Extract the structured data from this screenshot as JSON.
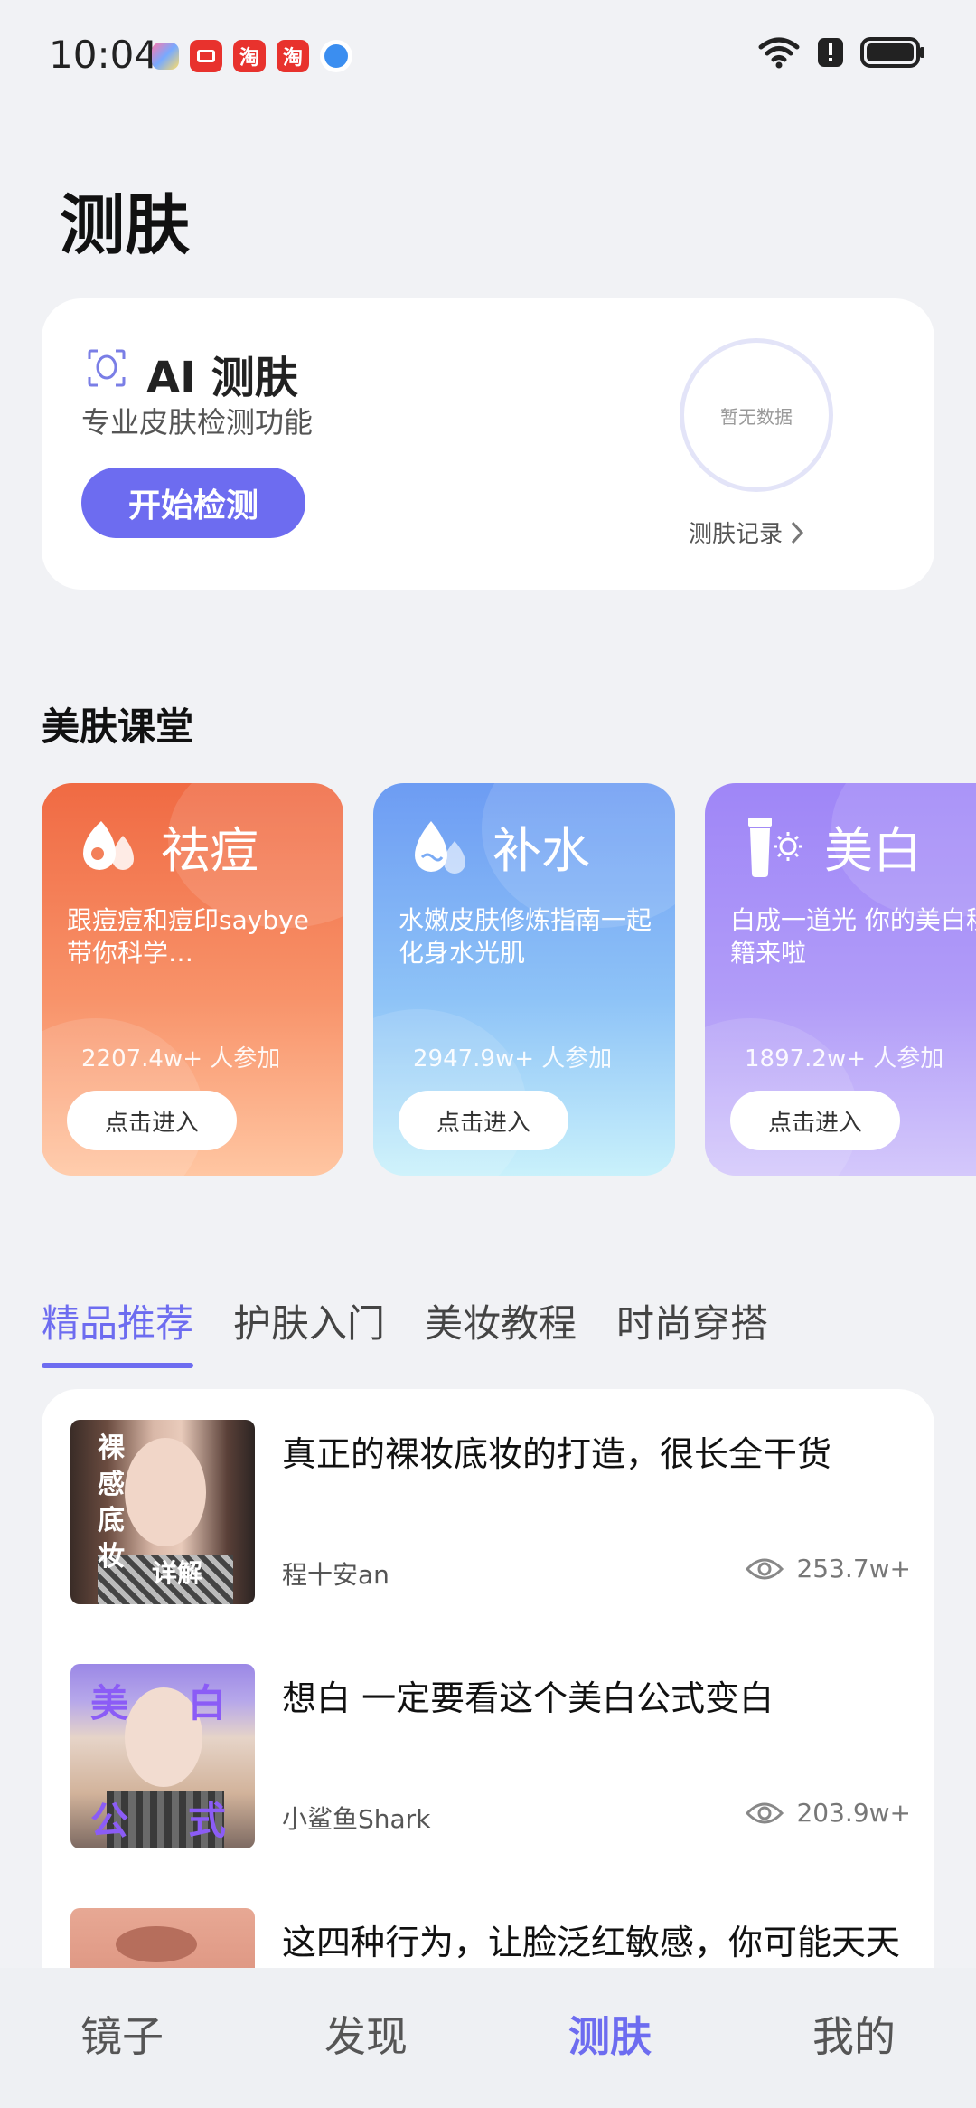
{
  "status_bar": {
    "time": "10:04",
    "app_icons": [
      "app-icon-colorful",
      "app-icon-red",
      "taobao-icon",
      "taobao-icon",
      "browser-icon"
    ],
    "indicators": [
      "wifi-icon",
      "alert-icon",
      "battery-icon"
    ]
  },
  "page": {
    "title": "测肤"
  },
  "ai_card": {
    "title": "AI 测肤",
    "subtitle": "专业皮肤检测功能",
    "start_button": "开始检测",
    "ring_text": "暂无数据",
    "record_link": "测肤记录"
  },
  "section": {
    "title": "美肤课堂"
  },
  "courses": [
    {
      "title": "祛痘",
      "desc": "跟痘痘和痘印saybye 带你科学…",
      "count": "2207.4w+ 人参加",
      "button": "点击进入",
      "icon": "acne-icon"
    },
    {
      "title": "补水",
      "desc": "水嫩皮肤修炼指南一起化身水光肌",
      "count": "2947.9w+ 人参加",
      "button": "点击进入",
      "icon": "water-drop-icon"
    },
    {
      "title": "美白",
      "desc": "白成一道光 你的美白秘籍来啦",
      "count": "1897.2w+ 人参加",
      "button": "点击进入",
      "icon": "sunscreen-icon"
    }
  ],
  "tabs": [
    "精品推荐",
    "护肤入门",
    "美妆教程",
    "时尚穿搭"
  ],
  "articles": [
    {
      "title": "真正的裸妆底妆的打造，很长全干货",
      "author": "程十安an",
      "views": "253.7w+",
      "thumb_text": [
        "裸",
        "感",
        "底",
        "妆",
        "详解"
      ]
    },
    {
      "title": "想白 一定要看这个美白公式变白",
      "author": "小鲨鱼Shark",
      "views": "203.9w+",
      "thumb_text": [
        "美",
        "白",
        "公",
        "式"
      ]
    },
    {
      "title": "这四种行为，让脸泛红敏感，你可能天天都在做",
      "author": "",
      "views": "",
      "thumb_text": []
    }
  ],
  "bottom_nav": [
    "镜子",
    "发现",
    "测肤",
    "我的"
  ],
  "colors": {
    "accent": "#6d6cf0",
    "acne": "#f06b45",
    "hydrate": "#6e9ff4",
    "whitening": "#a08cf6"
  }
}
